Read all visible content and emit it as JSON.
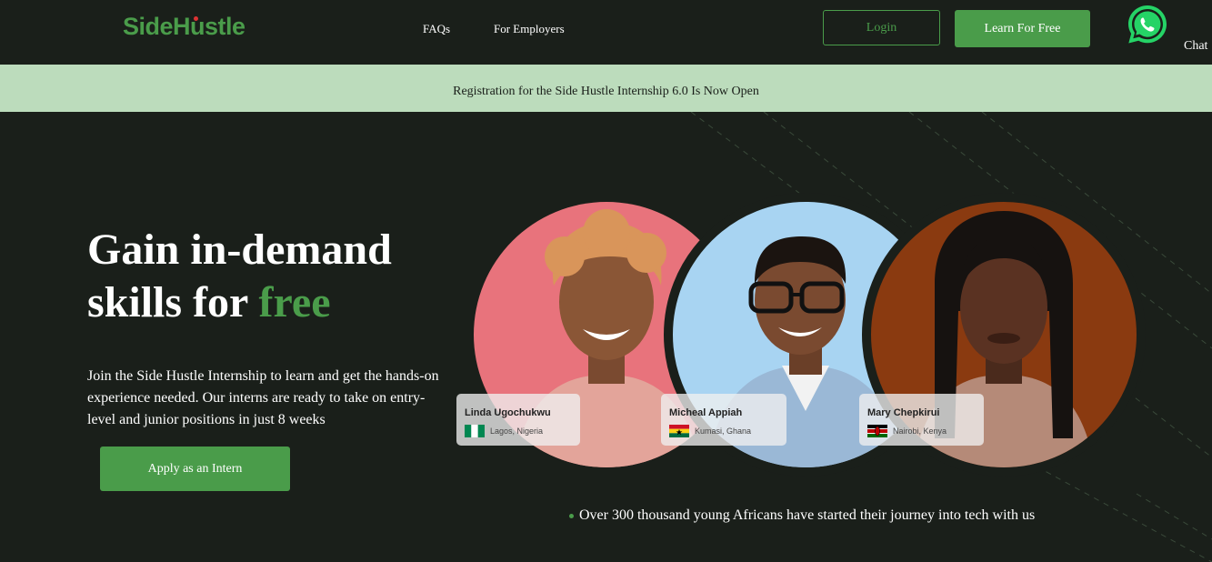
{
  "nav": {
    "logo": "SideHustle",
    "links": [
      "FAQs",
      "For Employers"
    ],
    "login_label": "Login",
    "learn_label": "Learn For Free",
    "chat_label": "Chat"
  },
  "banner": {
    "text": "Registration for the Side Hustle Internship 6.0 Is Now Open"
  },
  "hero": {
    "title_line1": "Gain in-demand",
    "title_line2_prefix": "skills for ",
    "title_line2_accent": "free",
    "subtitle": "Join the Side Hustle Internship to learn and get the hands-on experience needed. Our interns are ready to take on entry-level and junior positions in just 8 weeks",
    "apply_label": "Apply as an Intern"
  },
  "interns": [
    {
      "name": "Linda Ugochukwu",
      "location": "Lagos, Nigeria",
      "flag": "nigeria-flag-icon"
    },
    {
      "name": "Micheal Appiah",
      "location": "Kumasi, Ghana",
      "flag": "ghana-flag-icon"
    },
    {
      "name": "Mary Chepkirui",
      "location": "Nairobi, Kenya",
      "flag": "kenya-flag-icon"
    }
  ],
  "stat": {
    "text": "Over 300 thousand young Africans have started their journey into tech with us"
  },
  "colors": {
    "background": "#1a1f1a",
    "accent": "#4a9c4a",
    "banner": "#bcdcbc",
    "whatsapp": "#25d366"
  }
}
